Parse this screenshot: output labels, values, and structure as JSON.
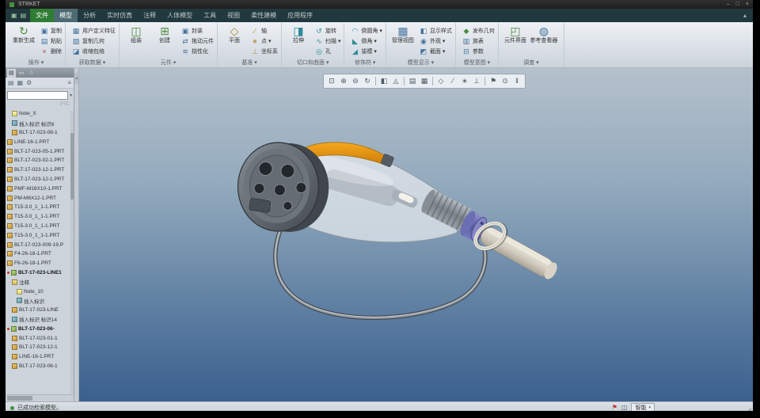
{
  "colors": {
    "model_orange": "#e0891a",
    "model_body_translucent": "#e0e6ea",
    "model_collar_purple": "#6a6db5",
    "model_handle_cream": "#d8d3c6",
    "viewport_gradient_top": "#b5c1cc",
    "viewport_gradient_bottom": "#3b608e",
    "ribbon_bg": "#d6dce3",
    "menubar_bg": "#21393e",
    "file_tab_green": "#2f7c33",
    "titlebar_bg": "#1d1d1d"
  },
  "titlebar": {
    "title": "STRKET",
    "controls": [
      {
        "g": "–",
        "n": "minimize-button"
      },
      {
        "g": "□",
        "n": "maximize-button"
      },
      {
        "g": "×",
        "n": "close-button"
      }
    ]
  },
  "menubar": {
    "quick_icons": [
      {
        "g": "▣",
        "n": "new-file-icon"
      },
      {
        "g": "▤",
        "n": "open-file-icon"
      }
    ],
    "tabs": [
      {
        "label": "文件",
        "state": "file"
      },
      {
        "label": "模型",
        "state": "active"
      },
      {
        "label": "分析"
      },
      {
        "label": "实时仿真"
      },
      {
        "label": "注释"
      },
      {
        "label": "人体模型"
      },
      {
        "label": "工具"
      },
      {
        "label": "视图"
      },
      {
        "label": "柔性建模"
      },
      {
        "label": "应用程序"
      }
    ],
    "right_icons": [
      {
        "g": "▴",
        "n": "collapse-ribbon-icon"
      }
    ]
  },
  "ribbon": {
    "groups": [
      {
        "label": "操作 ▾",
        "large": [
          {
            "t": "重新生成",
            "g": "↻",
            "c": "cg"
          }
        ],
        "small": [
          {
            "t": "复制",
            "g": "▣",
            "c": "cb"
          },
          {
            "t": "粘贴",
            "g": "▤",
            "c": "cb"
          },
          {
            "t": "删除",
            "g": "×",
            "c": "cr"
          }
        ]
      },
      {
        "label": "获取数据 ▾",
        "small": [
          {
            "t": "用户定义特征",
            "g": "▦",
            "c": "cb"
          },
          {
            "t": "复制几何",
            "g": "▧",
            "c": "cb"
          },
          {
            "t": "收缩包络",
            "g": "◪",
            "c": "cb"
          }
        ]
      },
      {
        "label": "元件 ▾",
        "large": [
          {
            "t": "组装",
            "g": "◫",
            "c": "cg"
          },
          {
            "t": "创建",
            "g": "⊞",
            "c": "cg"
          }
        ],
        "small": [
          {
            "t": "封装",
            "g": "▣",
            "c": "cb"
          },
          {
            "t": "拖动元件",
            "g": "⇄",
            "c": "cb"
          },
          {
            "t": "挠性化",
            "g": "≋",
            "c": "cb"
          }
        ]
      },
      {
        "label": "基准 ▾",
        "large": [
          {
            "t": "平面",
            "g": "◇",
            "c": "ct"
          }
        ],
        "small": [
          {
            "t": "轴",
            "g": "∕",
            "c": "ct"
          },
          {
            "t": "点 ▾",
            "g": "∗",
            "c": "ct"
          },
          {
            "t": "坐标系",
            "g": "⊥",
            "c": "ct"
          }
        ]
      },
      {
        "label": "切口和曲面 ▾",
        "large": [
          {
            "t": "拉伸",
            "g": "◨",
            "c": "co"
          }
        ],
        "small": [
          {
            "t": "旋转",
            "g": "↺",
            "c": "co"
          },
          {
            "t": "扫描 ▾",
            "g": "∿",
            "c": "co"
          },
          {
            "t": "孔",
            "g": "◎",
            "c": "co"
          }
        ]
      },
      {
        "label": "修饰符 ▾",
        "small": [
          {
            "t": "倒圆角 ▾",
            "g": "◠",
            "c": "co"
          },
          {
            "t": "倒角 ▾",
            "g": "◣",
            "c": "co"
          },
          {
            "t": "拔模 ▾",
            "g": "◢",
            "c": "co"
          }
        ]
      },
      {
        "label": "模型显示 ▾",
        "large": [
          {
            "t": "管理视图",
            "g": "▦",
            "c": "cb"
          }
        ],
        "small": [
          {
            "t": "显示样式",
            "g": "◧",
            "c": "cb"
          },
          {
            "t": "外观 ▾",
            "g": "◉",
            "c": "cb"
          },
          {
            "t": "截面 ▾",
            "g": "◩",
            "c": "cb"
          }
        ]
      },
      {
        "label": "模型意图 ▾",
        "small": [
          {
            "t": "发布几何",
            "g": "◆",
            "c": "cg"
          },
          {
            "t": "族表",
            "g": "▥",
            "c": "cb"
          },
          {
            "t": "参数",
            "g": "⊟",
            "c": "cb"
          }
        ]
      },
      {
        "label": "调查 ▾",
        "large": [
          {
            "t": "元件界面",
            "g": "◰",
            "c": "cg"
          },
          {
            "t": "参考查看器",
            "g": "◍",
            "c": "cb"
          }
        ]
      }
    ]
  },
  "navigator": {
    "header_tabs": [
      {
        "g": "▤",
        "n": "navigator-model-tree-tab",
        "s": "on"
      },
      {
        "g": "▭",
        "n": "navigator-folders-tab"
      },
      {
        "g": "☆",
        "n": "navigator-favorites-tab"
      }
    ],
    "tools": [
      {
        "g": "▤",
        "n": "tree-show-icon"
      },
      {
        "g": "▦",
        "n": "tree-columns-icon"
      },
      {
        "g": "⚙",
        "n": "tree-settings-icon"
      },
      {
        "g": "≡",
        "n": "tree-menu-icon",
        "k": "last"
      }
    ],
    "search": {
      "value": "",
      "chevron": "▾"
    },
    "watermark": "PTC",
    "sash_glyph": "◂",
    "items": [
      {
        "t": "Note_X",
        "ic": "note",
        "ind": "ind1"
      },
      {
        "t": "插入标识 标识6",
        "ic": "feat",
        "ind": "ind1"
      },
      {
        "t": "BLT-17-023-08-1",
        "ic": "part",
        "ind": "ind1"
      },
      {
        "t": "LINE-16-1.PRT",
        "ic": "part",
        "ind": "ind0"
      },
      {
        "t": "BLT-17-023-05-1.PRT",
        "ic": "part",
        "ind": "ind0"
      },
      {
        "t": "BLT-17-023-02-1.PRT",
        "ic": "part",
        "ind": "ind0"
      },
      {
        "t": "BLT-17-023-12-1.PRT",
        "ic": "part",
        "ind": "ind0"
      },
      {
        "t": "BLT-17-023-12-1.PRT",
        "ic": "part",
        "ind": "ind0"
      },
      {
        "t": "PMF-M16X10-1.PRT",
        "ic": "part",
        "ind": "ind0"
      },
      {
        "t": "PM-M6X12-1.PRT",
        "ic": "part",
        "ind": "ind0"
      },
      {
        "t": "T15-3.0_1_1-1.PRT",
        "ic": "part",
        "ind": "ind0"
      },
      {
        "t": "T15-3.0_1_1-1.PRT",
        "ic": "part",
        "ind": "ind0"
      },
      {
        "t": "T15-3.0_1_1-1.PRT",
        "ic": "part",
        "ind": "ind0"
      },
      {
        "t": "T15-3.0_1_1-1.PRT",
        "ic": "part",
        "ind": "ind0"
      },
      {
        "t": "BLT-17-023-009-19.P",
        "ic": "part",
        "ind": "ind0"
      },
      {
        "t": "F4-26-18-1.PRT",
        "ic": "part",
        "ind": "ind0"
      },
      {
        "t": "F6-26-18-1.PRT",
        "ic": "part",
        "ind": "ind0"
      },
      {
        "t": "BLT-17-023-LINE1",
        "ic": "asm",
        "ind": "ind0",
        "state": "mod"
      },
      {
        "t": "注释",
        "ic": "folder",
        "ind": "ind1"
      },
      {
        "t": "Note_10",
        "ic": "note",
        "ind": "ind2"
      },
      {
        "t": "插入标识",
        "ic": "feat",
        "ind": "ind2"
      },
      {
        "t": "BLT-17-023-LINE",
        "ic": "part",
        "ind": "ind1"
      },
      {
        "t": "插入标识 标识14",
        "ic": "feat",
        "ind": "ind1"
      },
      {
        "t": "BLT-17-023-06-",
        "ic": "asm",
        "ind": "ind0",
        "state": "mod"
      },
      {
        "t": "BLT-17-023-01-1",
        "ic": "part",
        "ind": "ind1"
      },
      {
        "t": "BLT-17-023-12-1",
        "ic": "part",
        "ind": "ind1"
      },
      {
        "t": "LINE-16-1.PRT",
        "ic": "part",
        "ind": "ind1"
      },
      {
        "t": "BLT-17-023-06-1",
        "ic": "part",
        "ind": "ind1"
      }
    ]
  },
  "viewport": {
    "toolbar": [
      {
        "g": "⊡",
        "n": "refit-icon"
      },
      {
        "g": "⊕",
        "n": "zoom-in-icon"
      },
      {
        "g": "⊖",
        "n": "zoom-out-icon"
      },
      {
        "g": "↻",
        "n": "repaint-icon"
      },
      {
        "g": "",
        "n": "separator",
        "k": "sep"
      },
      {
        "g": "◧",
        "n": "display-style-icon"
      },
      {
        "g": "◬",
        "n": "perspective-icon"
      },
      {
        "g": "",
        "n": "separator",
        "k": "sep"
      },
      {
        "g": "▤",
        "n": "saved-orientations-icon"
      },
      {
        "g": "▦",
        "n": "view-manager-icon"
      },
      {
        "g": "",
        "n": "separator",
        "k": "sep"
      },
      {
        "g": "◇",
        "n": "datum-plane-display-icon"
      },
      {
        "g": "∕",
        "n": "datum-axis-display-icon"
      },
      {
        "g": "∗",
        "n": "datum-point-display-icon"
      },
      {
        "g": "⊥",
        "n": "csys-display-icon"
      },
      {
        "g": "",
        "n": "separator",
        "k": "sep"
      },
      {
        "g": "⚑",
        "n": "annotation-display-icon"
      },
      {
        "g": "⊙",
        "n": "spin-center-icon"
      },
      {
        "g": "‖",
        "n": "pause-icon"
      }
    ]
  },
  "statusbar": {
    "message": "已成功检索模型。",
    "icons": [
      {
        "g": "⚑",
        "n": "notification-flag-icon",
        "c": "red"
      },
      {
        "g": "◫",
        "n": "display-toggle-icon"
      }
    ],
    "filter": {
      "label": "智能",
      "chevron": "▾"
    },
    "grip": "◢"
  }
}
